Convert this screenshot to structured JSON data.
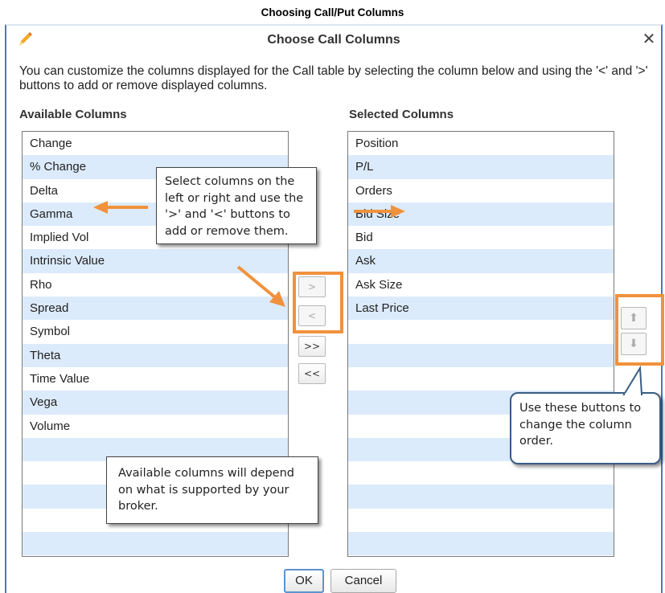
{
  "page": {
    "heading": "Choosing Call/Put Columns"
  },
  "dialog": {
    "title": "Choose Call Columns",
    "close_glyph": "✕",
    "description": "You can customize the columns displayed for the Call table by selecting the column below and using the '<' and '>' buttons to add or remove displayed columns."
  },
  "available": {
    "header": "Available Columns",
    "items": [
      "Change",
      "% Change",
      "Delta",
      "Gamma",
      "Implied Vol",
      "Intrinsic Value",
      "Rho",
      "Spread",
      "Symbol",
      "Theta",
      "Time Value",
      "Vega",
      "Volume",
      "",
      "",
      "",
      "",
      "",
      ""
    ]
  },
  "selected": {
    "header": "Selected Columns",
    "items": [
      "Position",
      "P/L",
      "Orders",
      "Bid Size",
      "Bid",
      "Ask",
      "Ask Size",
      "Last Price",
      "",
      "",
      "",
      "",
      "",
      "",
      "",
      "",
      "",
      "",
      ""
    ]
  },
  "transfer_buttons": {
    "add": ">",
    "remove": "<",
    "add_all": ">>",
    "remove_all": "<<"
  },
  "order_buttons": {
    "up": "⬆",
    "down": "⬇"
  },
  "callouts": {
    "select": "Select columns on the left or right and use the '>' and '<' buttons to add or remove them.",
    "order": "Use these buttons to change the column order.",
    "broker": "Available columns will depend on what is supported by your broker."
  },
  "footer": {
    "ok": "OK",
    "cancel": "Cancel"
  },
  "colors": {
    "accent": "#f0923d",
    "row_alt": "#dcebfb",
    "dialog_border": "#3a7fc8",
    "pencil": "#f5a623"
  },
  "icons": [
    "pencil-icon",
    "close-icon",
    "arrow-up-icon",
    "arrow-down-icon"
  ]
}
